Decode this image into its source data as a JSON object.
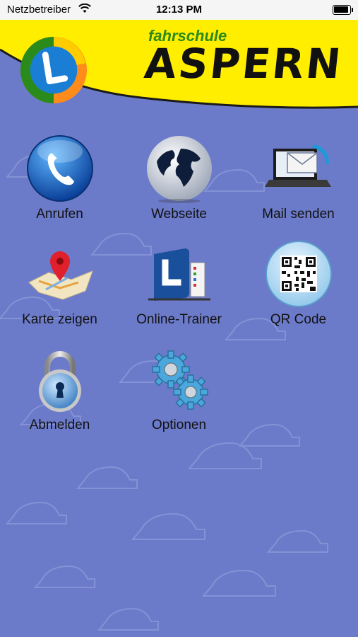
{
  "status_bar": {
    "carrier": "Netzbetreiber",
    "time": "12:13 PM"
  },
  "header": {
    "brand_small": "fahrschule",
    "brand_large": "ASPERN"
  },
  "tiles": [
    {
      "label": "Anrufen",
      "icon": "phone-icon"
    },
    {
      "label": "Webseite",
      "icon": "globe-icon"
    },
    {
      "label": "Mail senden",
      "icon": "mail-laptop-icon"
    },
    {
      "label": "Karte zeigen",
      "icon": "map-pin-icon"
    },
    {
      "label": "Online-Trainer",
      "icon": "l-plate-icon"
    },
    {
      "label": "QR Code",
      "icon": "qr-code-icon"
    },
    {
      "label": "Abmelden",
      "icon": "padlock-icon"
    },
    {
      "label": "Optionen",
      "icon": "gears-icon"
    }
  ],
  "colors": {
    "background": "#6c7bc9",
    "header_yellow": "#ffee00",
    "brand_green": "#2a8a1a"
  }
}
